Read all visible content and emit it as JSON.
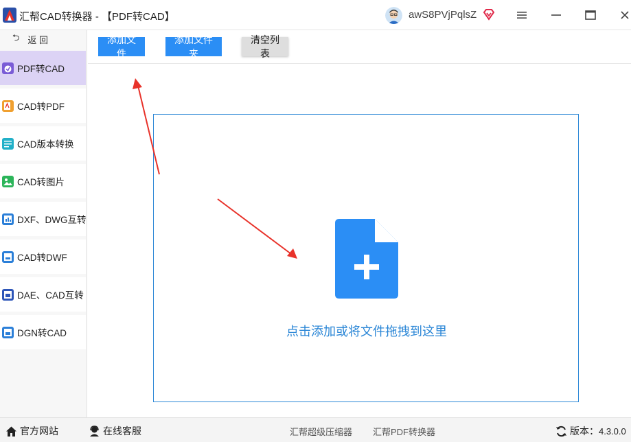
{
  "titlebar": {
    "app_title": "汇帮CAD转换器 - 【PDF转CAD】",
    "username": "awS8PVjPqlsZ"
  },
  "sidebar": {
    "back_label": "返 回",
    "back_arrow": "⮌",
    "items": [
      {
        "label": "PDF转CAD",
        "active": true
      },
      {
        "label": "CAD转PDF"
      },
      {
        "label": "CAD版本转换"
      },
      {
        "label": "CAD转图片"
      },
      {
        "label": "DXF、DWG互转"
      },
      {
        "label": "CAD转DWF"
      },
      {
        "label": "DAE、CAD互转"
      },
      {
        "label": "DGN转CAD"
      }
    ]
  },
  "toolbar": {
    "add_file_label": "添加文件",
    "add_folder_label": "添加文件夹",
    "clear_list_label": "清空列表"
  },
  "dropzone": {
    "hint": "点击添加或将文件拖拽到这里"
  },
  "footer": {
    "official_site": "官方网站",
    "online_service": "在线客服",
    "link_compressor": "汇帮超级压缩器",
    "link_pdf_converter": "汇帮PDF转换器",
    "version_label": "版本：",
    "version_value": "4.3.0.0"
  },
  "colors": {
    "accent_blue": "#2b8ef5",
    "active_nav_bg": "#dcd3f5",
    "dropzone_border": "#2a86d6",
    "annotation_red": "#e8322a"
  },
  "icons": [
    "app-logo-icon",
    "avatar-icon",
    "vip-diamond-icon",
    "menu-icon",
    "minimize-icon",
    "maximize-icon",
    "close-icon",
    "back-arrow-icon",
    "file-plus-icon",
    "home-icon",
    "headset-icon",
    "refresh-icon"
  ]
}
